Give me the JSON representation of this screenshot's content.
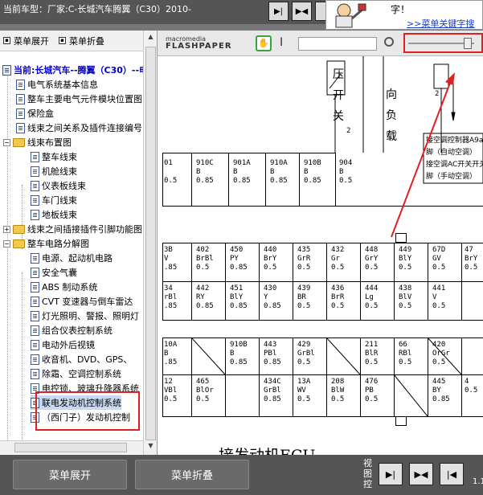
{
  "window": {
    "title": "当前车型：厂家:C-长城汽车腾翼（C30）2010-"
  },
  "ad": {
    "question_fragment": "字！",
    "link": ">>菜单关键字搜"
  },
  "left_toolbar": {
    "expand": "菜单展开",
    "collapse": "菜单折叠"
  },
  "tree": {
    "root": "当前:长城汽车--腾翼（C30）--电",
    "items": [
      "电气系统基本信息",
      "整车主要电气元件模块位置图",
      "保险盒",
      "线束之间关系及插件连接编号",
      "线束布置图",
      "整车线束",
      "机舱线束",
      "仪表板线束",
      "车门线束",
      "地板线束",
      "线束之间插接插件引脚功能图",
      "整车电路分解图",
      "电源、起动机电路",
      "安全气囊",
      "ABS 制动系统",
      "CVT 变速器与倒车雷达",
      "灯光照明、警报、照明灯",
      "组合仪表控制系统",
      "电动外后视镜",
      "收音机、DVD、GPS、",
      "除霜、空调控制系统",
      "电控锁、玻璃升降器系统",
      "联电发动机控制系统",
      "（西门子）发动机控制"
    ]
  },
  "viewer": {
    "logo_line1": "macromedia",
    "logo_line2": "FLASHPAPER",
    "hand_tool": "✋",
    "text_tool": "I",
    "search_placeholder": "",
    "zoom_level": 0.95
  },
  "doc": {
    "top_labels": [
      "压",
      "开",
      "关",
      "向",
      "负",
      "载",
      "2",
      "2"
    ],
    "note1": "接空调控制器A9a",
    "note2": "脚（自动空调）",
    "note3": "接空调AC开关开关",
    "note4": "脚（手动空调）",
    "row1": [
      "01\n\n0.5",
      "910C\nB\n0.85",
      "901A\nB\n0.85",
      "910A\nB\n0.85",
      "910B\nB\n0.85",
      "904\nB\n0.5"
    ],
    "row2": [
      "3B\nV\n.85",
      "402\nBrBl\n0.5",
      "450\nPY\n0.85",
      "440\nBrY\n0.5",
      "435\nGrR\n0.5",
      "432\nGr\n0.5",
      "448\nGrY\n0.5",
      "449\nBlY\n0.5",
      "67D\nGV\n0.5",
      "47\nBrY\n0.5"
    ],
    "row3": [
      "34\nrBl\n.85",
      "442\nRY\n0.85",
      "451\nBlY\n0.85",
      "430\nY\n0.85",
      "439\nBR\n0.5",
      "436\nBrR\n0.5",
      "444\nLg\n0.5",
      "438\nBlV\n0.5",
      "441\nV\n0.5"
    ],
    "row4": [
      "10A\nB\n.85",
      "910B\nB\n0.85",
      "443\nPBl\n0.85",
      "429\nGrBl\n0.5",
      "211\nBlR\n0.5",
      "66\nRBl\n0.5",
      "420\nOrGr\n0.5"
    ],
    "row5": [
      "12\nVBl\n0.5",
      "465\nBlOr\n0.5",
      "434C\nGrBl\n0.85",
      "13A\nWV\n0.5",
      "208\nBlW\n0.5",
      "476\nPB\n0.5",
      "445\nBY\n0.85",
      "4\n0.5"
    ],
    "ecu_label": "接发动机ECU"
  },
  "bottom": {
    "expand": "菜单展开",
    "collapse": "菜单折叠",
    "view_control": "视图控",
    "page_number": "1.1"
  },
  "colors": {
    "annotation_red": "#e02020",
    "chrome_dark": "#555555"
  }
}
